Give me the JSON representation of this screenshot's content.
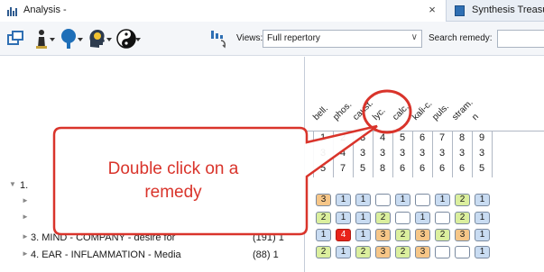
{
  "tabs": {
    "active_label": "Analysis -",
    "close_symbol": "×",
    "other_label": "Synthesis Treasu"
  },
  "toolbar": {
    "views_label": "Views:",
    "views_value": "Full repertory",
    "search_label": "Search remedy:"
  },
  "remedies": [
    "bell.",
    "phos.",
    "caust.",
    "lyc.",
    "calc.",
    "kali-c.",
    "puls.",
    "stram.",
    "n"
  ],
  "column_numbers": [
    "1",
    "2",
    "3",
    "4",
    "5",
    "6",
    "7",
    "8",
    "9"
  ],
  "totals_row1": [
    "3",
    "4",
    "3",
    "3",
    "3",
    "3",
    "3",
    "3",
    "3"
  ],
  "totals_row2": [
    "5",
    "7",
    "5",
    "8",
    "6",
    "6",
    "6",
    "6",
    "5"
  ],
  "rubrics": [
    {
      "name": "1. ",
      "count": ""
    },
    {
      "name": "",
      "count": ""
    },
    {
      "name": "",
      "count": ""
    },
    {
      "name": "3. MIND - COMPANY - desire for",
      "count": "(191) 1"
    },
    {
      "name": "4. EAR - INFLAMMATION - Media",
      "count": "(88) 1"
    }
  ],
  "grid_rows": [
    [
      "3",
      "1",
      "1",
      "",
      "1",
      "",
      "1",
      "2",
      "1"
    ],
    [
      "2",
      "1",
      "1",
      "2",
      "",
      "1",
      "",
      "2",
      "1"
    ],
    [
      "1",
      "4",
      "1",
      "3",
      "2",
      "3",
      "2",
      "3",
      "1"
    ],
    [
      "2",
      "1",
      "2",
      "3",
      "2",
      "3",
      "",
      "",
      "1"
    ]
  ],
  "callout": {
    "line1": "Double click  on a",
    "line2": "remedy"
  },
  "colors": {
    "grade1": "#c9dcf2",
    "grade2": "#dbef9e",
    "grade3": "#f6c688",
    "grade4": "#e8231a",
    "callout": "#d9342b"
  }
}
